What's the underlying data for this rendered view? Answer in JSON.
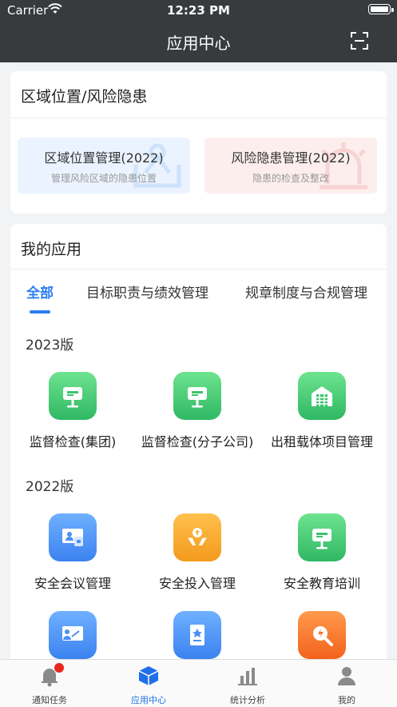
{
  "status": {
    "carrier": "Carrier",
    "time": "12:23 PM"
  },
  "nav": {
    "title": "应用中心"
  },
  "region": {
    "title": "区域位置/风险隐患",
    "tiles": [
      {
        "title": "区域位置管理(2022)",
        "subtitle": "管理风险区域的隐患位置"
      },
      {
        "title": "风险隐患管理(2022)",
        "subtitle": "隐患的检查及整改"
      }
    ]
  },
  "apps": {
    "title": "我的应用",
    "tabs": [
      "全部",
      "目标职责与绩效管理",
      "规章制度与合规管理"
    ],
    "sections": [
      {
        "label": "2023版",
        "items": [
          "监督检查(集团)",
          "监督检查(分子公司)",
          "出租载体项目管理"
        ]
      },
      {
        "label": "2022版",
        "items": [
          "安全会议管理",
          "安全投入管理",
          "安全教育培训"
        ]
      }
    ]
  },
  "tabbar": {
    "items": [
      "通知任务",
      "应用中心",
      "统计分析",
      "我的"
    ],
    "active": "应用中心"
  },
  "colors": {
    "accent": "#2a7df0",
    "nav_bg": "#373b3e",
    "badge": "#e8281f"
  }
}
